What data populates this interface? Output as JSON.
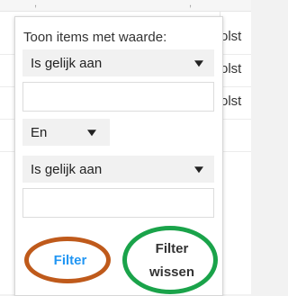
{
  "background": {
    "cells": [
      "olst",
      "olst",
      "olst"
    ]
  },
  "filter_panel": {
    "title": "Toon items met waarde:",
    "condition1": {
      "selected": "Is gelijk aan"
    },
    "value1": "",
    "logic": {
      "selected": "En"
    },
    "condition2": {
      "selected": "Is gelijk aan"
    },
    "value2": "",
    "filter_label": "Filter",
    "clear_label_line1": "Filter",
    "clear_label_line2": "wissen"
  },
  "annotations": {
    "filter_ellipse_color": "#bf5a1b",
    "clear_ellipse_color": "#1aa34a"
  },
  "colors": {
    "accent": "#2196f3"
  }
}
